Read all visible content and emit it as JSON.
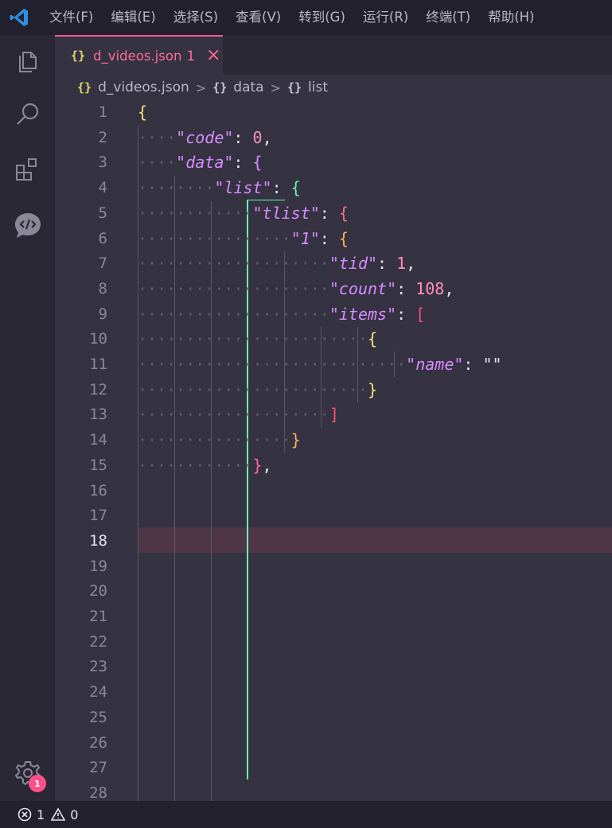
{
  "menu": [
    "文件(F)",
    "编辑(E)",
    "选择(S)",
    "查看(V)",
    "转到(G)",
    "运行(R)",
    "终端(T)",
    "帮助(H)"
  ],
  "activity": {
    "icons": [
      "files-icon",
      "search-icon",
      "extensions-icon",
      "live-share-icon"
    ],
    "settings_badge": "1"
  },
  "tab": {
    "icon": "{}",
    "label": "d_videos.json",
    "problems": "1",
    "close": "×"
  },
  "breadcrumb": {
    "icon": "{}",
    "file": "d_videos.json",
    "sep": ">",
    "seg1": "data",
    "seg2": "list"
  },
  "editor": {
    "active_line": 18,
    "line_count": 28,
    "lines": [
      "{",
      "    \"code\": 0,",
      "    \"data\": {",
      "        \"list\": {",
      "            \"tlist\": {",
      "                \"1\": {",
      "                    \"tid\": 1,",
      "                    \"count\": 108,",
      "                    \"items\": [",
      "                        {",
      "                            \"name\": \"\"",
      "                        }",
      "                    ]",
      "                }",
      "            },",
      "",
      "",
      "",
      "",
      "",
      "",
      "",
      "",
      "",
      "",
      "",
      "",
      ""
    ]
  },
  "status": {
    "errors": "1",
    "warnings": "0"
  },
  "colors": {
    "accent": "#ff5a8f",
    "active_guide": "#6af0b8",
    "key": "#d88bff",
    "number": "#ff8fb8"
  }
}
